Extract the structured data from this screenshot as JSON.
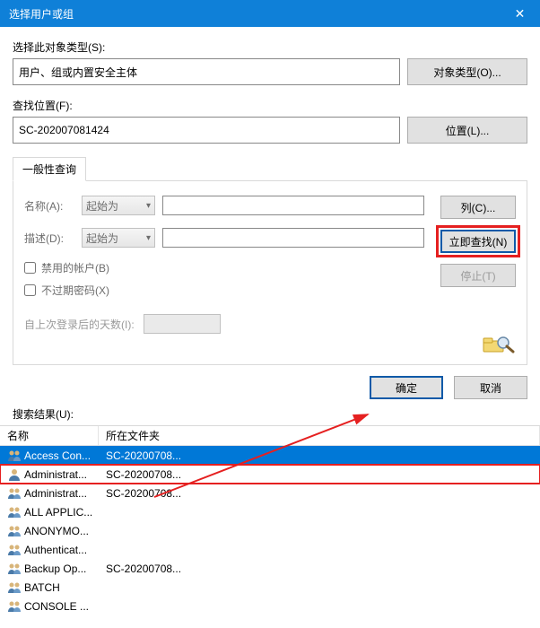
{
  "window": {
    "title": "选择用户或组"
  },
  "objectType": {
    "label": "选择此对象类型(S):",
    "value": "用户、组或内置安全主体",
    "button": "对象类型(O)..."
  },
  "location": {
    "label": "查找位置(F):",
    "value": "SC-202007081424",
    "button": "位置(L)..."
  },
  "tabs": {
    "common": "一般性查询"
  },
  "query": {
    "nameLabel": "名称(A):",
    "descLabel": "描述(D):",
    "startsWith": "起始为",
    "disabledAcct": "禁用的帐户(B)",
    "nonExpirePwd": "不过期密码(X)",
    "daysSinceLogin": "自上次登录后的天数(I):"
  },
  "rightButtons": {
    "columns": "列(C)...",
    "findNow": "立即查找(N)",
    "stop": "停止(T)"
  },
  "ok": "确定",
  "cancel": "取消",
  "resultsLabel": "搜索结果(U):",
  "columns": {
    "name": "名称",
    "folder": "所在文件夹"
  },
  "rows": [
    {
      "name": "Access Con...",
      "folder": "SC-20200708...",
      "type": "group",
      "selected": true
    },
    {
      "name": "Administrat...",
      "folder": "SC-20200708...",
      "type": "user",
      "highlighted": true
    },
    {
      "name": "Administrat...",
      "folder": "SC-20200708...",
      "type": "group"
    },
    {
      "name": "ALL APPLIC...",
      "folder": "",
      "type": "group"
    },
    {
      "name": "ANONYMO...",
      "folder": "",
      "type": "group"
    },
    {
      "name": "Authenticat...",
      "folder": "",
      "type": "group"
    },
    {
      "name": "Backup Op...",
      "folder": "SC-20200708...",
      "type": "group"
    },
    {
      "name": "BATCH",
      "folder": "",
      "type": "group"
    },
    {
      "name": "CONSOLE ...",
      "folder": "",
      "type": "group"
    }
  ]
}
